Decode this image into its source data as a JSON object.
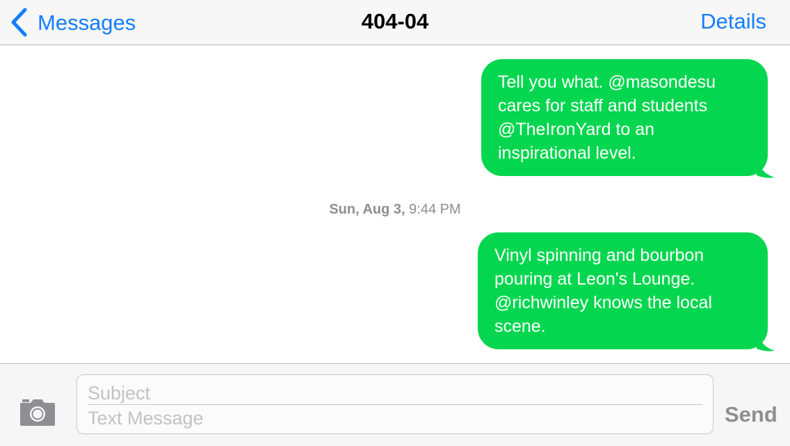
{
  "navbar": {
    "back_label": "Messages",
    "title": "404-04",
    "details_label": "Details"
  },
  "messages": [
    {
      "direction": "outgoing",
      "text": "Tell you what. @masondesu\ncares for staff and students\n@TheIronYard to an\ninspirational level."
    },
    {
      "direction": "outgoing",
      "text": "Vinyl spinning and bourbon\npouring at Leon's Lounge.\n@richwinley knows the local\nscene."
    }
  ],
  "timestamp": {
    "date": "Sun, Aug 3,",
    "time": "9:44 PM"
  },
  "composer": {
    "subject_placeholder": "Subject",
    "message_placeholder": "Text Message",
    "send_label": "Send",
    "camera_icon": "camera-icon"
  },
  "colors": {
    "accent": "#157efb",
    "bubble": "#04d64f",
    "secondary_text": "#8e8e93"
  }
}
